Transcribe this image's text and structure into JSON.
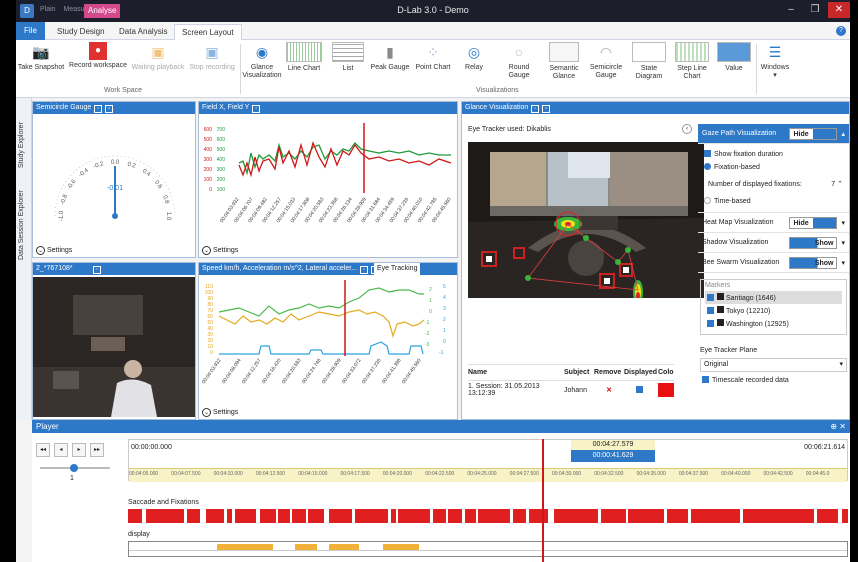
{
  "window": {
    "title": "D-Lab 3.0 - Demo",
    "quick_access": [
      "Plain",
      "Measure"
    ],
    "context_tab": "Analyse",
    "minimize": "–",
    "maximize": "❐",
    "close": "✕"
  },
  "tabs": {
    "file": "File",
    "items": [
      "Study Design",
      "Data Analysis",
      "Screen Layout"
    ],
    "help": "?"
  },
  "ribbon": {
    "workspace_group": "Work Space",
    "visualizations_group": "Visualizations",
    "workspace": [
      {
        "label": "Take Snapshot",
        "icon": "camera-icon"
      },
      {
        "label": "Record workspace",
        "icon": "record-icon"
      },
      {
        "label": "Waiting playback",
        "icon": "playback-icon"
      },
      {
        "label": "Stop recording",
        "icon": "stop-icon"
      }
    ],
    "visualizations": [
      {
        "label1": "Glance",
        "label2": "Visualization",
        "icon": "eye-icon"
      },
      {
        "label1": "Line Chart",
        "label2": "",
        "icon": "line-chart-icon"
      },
      {
        "label1": "List",
        "label2": "",
        "icon": "list-icon"
      },
      {
        "label1": "Peak Gauge",
        "label2": "",
        "icon": "peak-gauge-icon"
      },
      {
        "label1": "Point Chart",
        "label2": "",
        "icon": "point-chart-icon"
      },
      {
        "label1": "Relay",
        "label2": "",
        "icon": "relay-icon"
      },
      {
        "label1": "Round",
        "label2": "Gauge",
        "icon": "round-gauge-icon"
      },
      {
        "label1": "Semantic",
        "label2": "Glance",
        "icon": "semantic-glance-icon"
      },
      {
        "label1": "Semicircle",
        "label2": "Gauge",
        "icon": "semicircle-gauge-icon"
      },
      {
        "label1": "State",
        "label2": "Diagram",
        "icon": "state-diagram-icon"
      },
      {
        "label1": "Step Line",
        "label2": "Chart",
        "icon": "step-line-icon"
      },
      {
        "label1": "Value",
        "label2": "",
        "icon": "value-icon"
      },
      {
        "label1": "Windows",
        "label2": "",
        "icon": "windows-icon"
      }
    ]
  },
  "sidebar": {
    "explorers": [
      "Study Explorer",
      "Data Session Explorer"
    ]
  },
  "semicircle_panel": {
    "title": "Semicircle Gauge",
    "tick_labels": [
      "-1.0",
      "-0.8",
      "-0.6",
      "-0.4",
      "-0.2",
      "0.0",
      "0.2",
      "0.4",
      "0.6",
      "0.8",
      "1.0"
    ],
    "value": "-0.01",
    "settings": "Settings"
  },
  "field_panel": {
    "title": "Field X, Field Y",
    "settings": "Settings",
    "x_ticks": [
      "00:04:03.932",
      "00:04:06.707",
      "00:04:09.482",
      "00:04:12.257",
      "00:04:15.033",
      "00:04:17.808",
      "00:04:20.583",
      "00:04:23.358",
      "00:04:26.134",
      "00:04:28.909",
      "00:04:31.684",
      "00:04:34.459",
      "00:04:37.235",
      "00:04:40.010",
      "00:04:42.785",
      "00:04:45.560"
    ]
  },
  "video_panel": {
    "title": "2_*767108*"
  },
  "speed_panel": {
    "title": "Speed km/h, Acceleration m/s^2, Lateral acceler...",
    "eye_tracking": "Eye Tracking",
    "settings": "Settings",
    "x_ticks": [
      "00:04:03.932",
      "00:04:08.094",
      "00:04:12.257",
      "00:04:16.420",
      "00:04:20.583",
      "00:04:24.746",
      "00:04:28.909",
      "00:04:33.072",
      "00:04:37.235",
      "00:04:41.398",
      "00:04:45.560"
    ]
  },
  "glance_panel": {
    "title": "Glance Visualization",
    "tracker": "Eye Tracker used: Dikablis",
    "table_headers": [
      "Name",
      "Subject",
      "Remove",
      "Displayed",
      "Colo"
    ],
    "table_rows": [
      {
        "name": "1. Session: 31.05.2013 13:12:39",
        "subject": "Johann",
        "remove": "✕",
        "color": "#e81010"
      }
    ]
  },
  "right_panel": {
    "gaze_path": "Gaze Path Visualization",
    "hide": "Hide",
    "show": "Show",
    "show_fixation_duration": "Show fixation duration",
    "fixation_based": "Fixation-based",
    "num_fixations_label": "Number of displayed fixations:",
    "num_fixations": "7",
    "time_based": "Time-based",
    "heat_map": "Heat Map Visualization",
    "shadow": "Shadow Visualization",
    "bee_swarm": "Bee Swarm Visualization",
    "markers_title": "Markers",
    "markers": [
      "Santiago (1646)",
      "Tokyo (12210)",
      "Washington (12925)"
    ],
    "eye_tracker_plane": "Eye Tracker Plane",
    "plane_value": "Original",
    "timescale": "Timescale recorded data"
  },
  "player": {
    "title": "Player",
    "start_time": "00:00:00.000",
    "end_time": "00:06:21.614",
    "cursor_time": "00:04:27.579",
    "window_time": "00:00:41.629",
    "speed": "1",
    "ruler": [
      "00:04:05.000",
      "00:04:07.500",
      "00:04:10.000",
      "00:04:12.500",
      "00:04:15.000",
      "00:04:17.500",
      "00:04:20.000",
      "00:04:22.500",
      "00:04:25.000",
      "00:04:27.500",
      "00:04:30.000",
      "00:04:32.500",
      "00:04:35.000",
      "00:04:37.500",
      "00:04:40.000",
      "00:04:42.500",
      "00:04:45.0"
    ],
    "track1": "Saccade and Fixations",
    "track2": "display"
  },
  "colors": {
    "accent": "#2e78c8",
    "field_x": "#d01616",
    "field_y": "#1e9a3a",
    "speed": "#e3a91a",
    "accel": "#4ab94a",
    "lateral": "#2aa3e0",
    "cursor": "#d01616"
  }
}
